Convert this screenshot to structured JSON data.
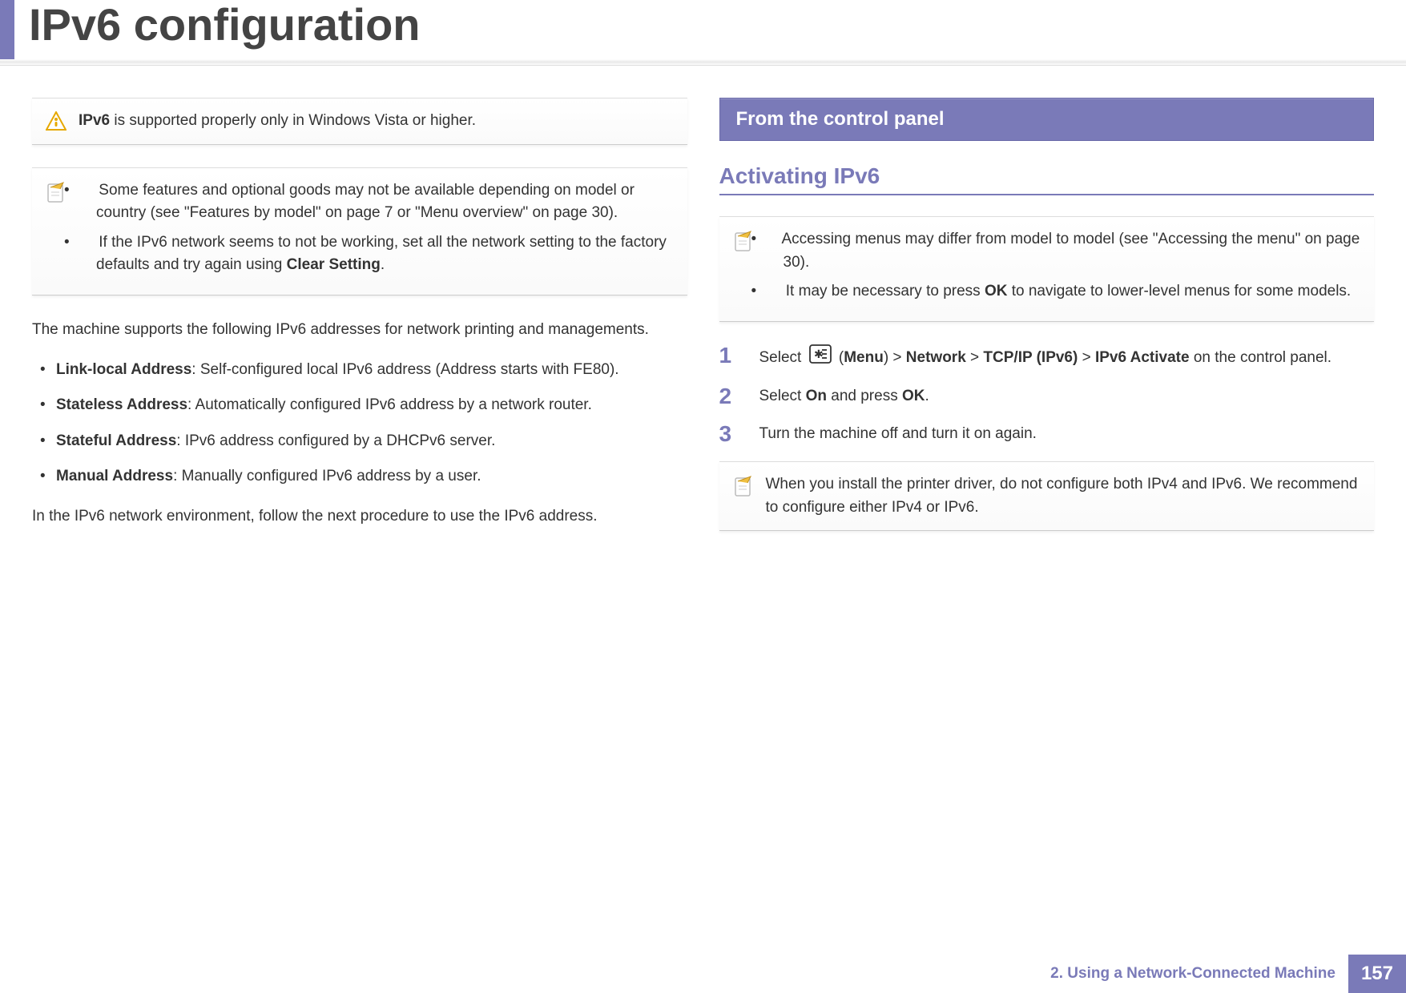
{
  "page_title": "IPv6 configuration",
  "left": {
    "warning_text_prefix": "IPv6",
    "warning_text_rest": " is supported properly only in Windows Vista or higher.",
    "note1_bullet1_part1": "Some features and optional goods may not be available depending on model or country (see \"Features by model\" on page 7 ",
    "note1_bullet1_or": "or",
    "note1_bullet1_part2": " \"Menu overview\" on page 30).",
    "note1_bullet2_part1": "If the IPv6 network seems to not be working, set all the network setting to the factory defaults and try again using ",
    "note1_bullet2_bold": "Clear Setting",
    "note1_bullet2_part2": ".",
    "intro1": "The machine supports the following IPv6 addresses for network printing and managements.",
    "addr1_label": "Link-local Address",
    "addr1_desc": ": Self-configured local IPv6 address (Address starts with FE80).",
    "addr2_label": "Stateless Address",
    "addr2_desc": ": Automatically configured IPv6 address by a network router.",
    "addr3_label": "Stateful Address",
    "addr3_desc": ": IPv6 address configured by a DHCPv6 server.",
    "addr4_label": "Manual Address",
    "addr4_desc": ": Manually configured IPv6 address by a user.",
    "outro": "In the IPv6 network environment, follow the next procedure to use the IPv6 address."
  },
  "right": {
    "section_heading": "From the control panel",
    "subheading": "Activating IPv6",
    "note2_bullet1": "Accessing menus may differ from model to model (see \"Accessing the menu\" on page 30).",
    "note2_bullet2_part1": "It may be necessary to press ",
    "note2_bullet2_bold": "OK",
    "note2_bullet2_part2": " to navigate to lower-level menus for some models.",
    "step1_num": "1",
    "step1_pre": "Select ",
    "step1_menu": "Menu",
    "step1_gt1": " > ",
    "step1_network": "Network",
    "step1_gt2": " > ",
    "step1_tcpip": "TCP/IP (IPv6)",
    "step1_gt3": " > ",
    "step1_activate": "IPv6 Activate",
    "step1_post": " on the control panel.",
    "step2_num": "2",
    "step2_part1": "Select ",
    "step2_on": "On",
    "step2_part2": " and press ",
    "step2_ok": "OK",
    "step2_part3": ".",
    "step3_num": "3",
    "step3_text": "Turn the machine off and turn it on again.",
    "note3_text": "When you install the printer driver, do not configure both IPv4 and IPv6. We recommend to configure either IPv4 or IPv6."
  },
  "footer": {
    "chapter": "2.  Using a Network-Connected Machine",
    "page_number": "157"
  }
}
